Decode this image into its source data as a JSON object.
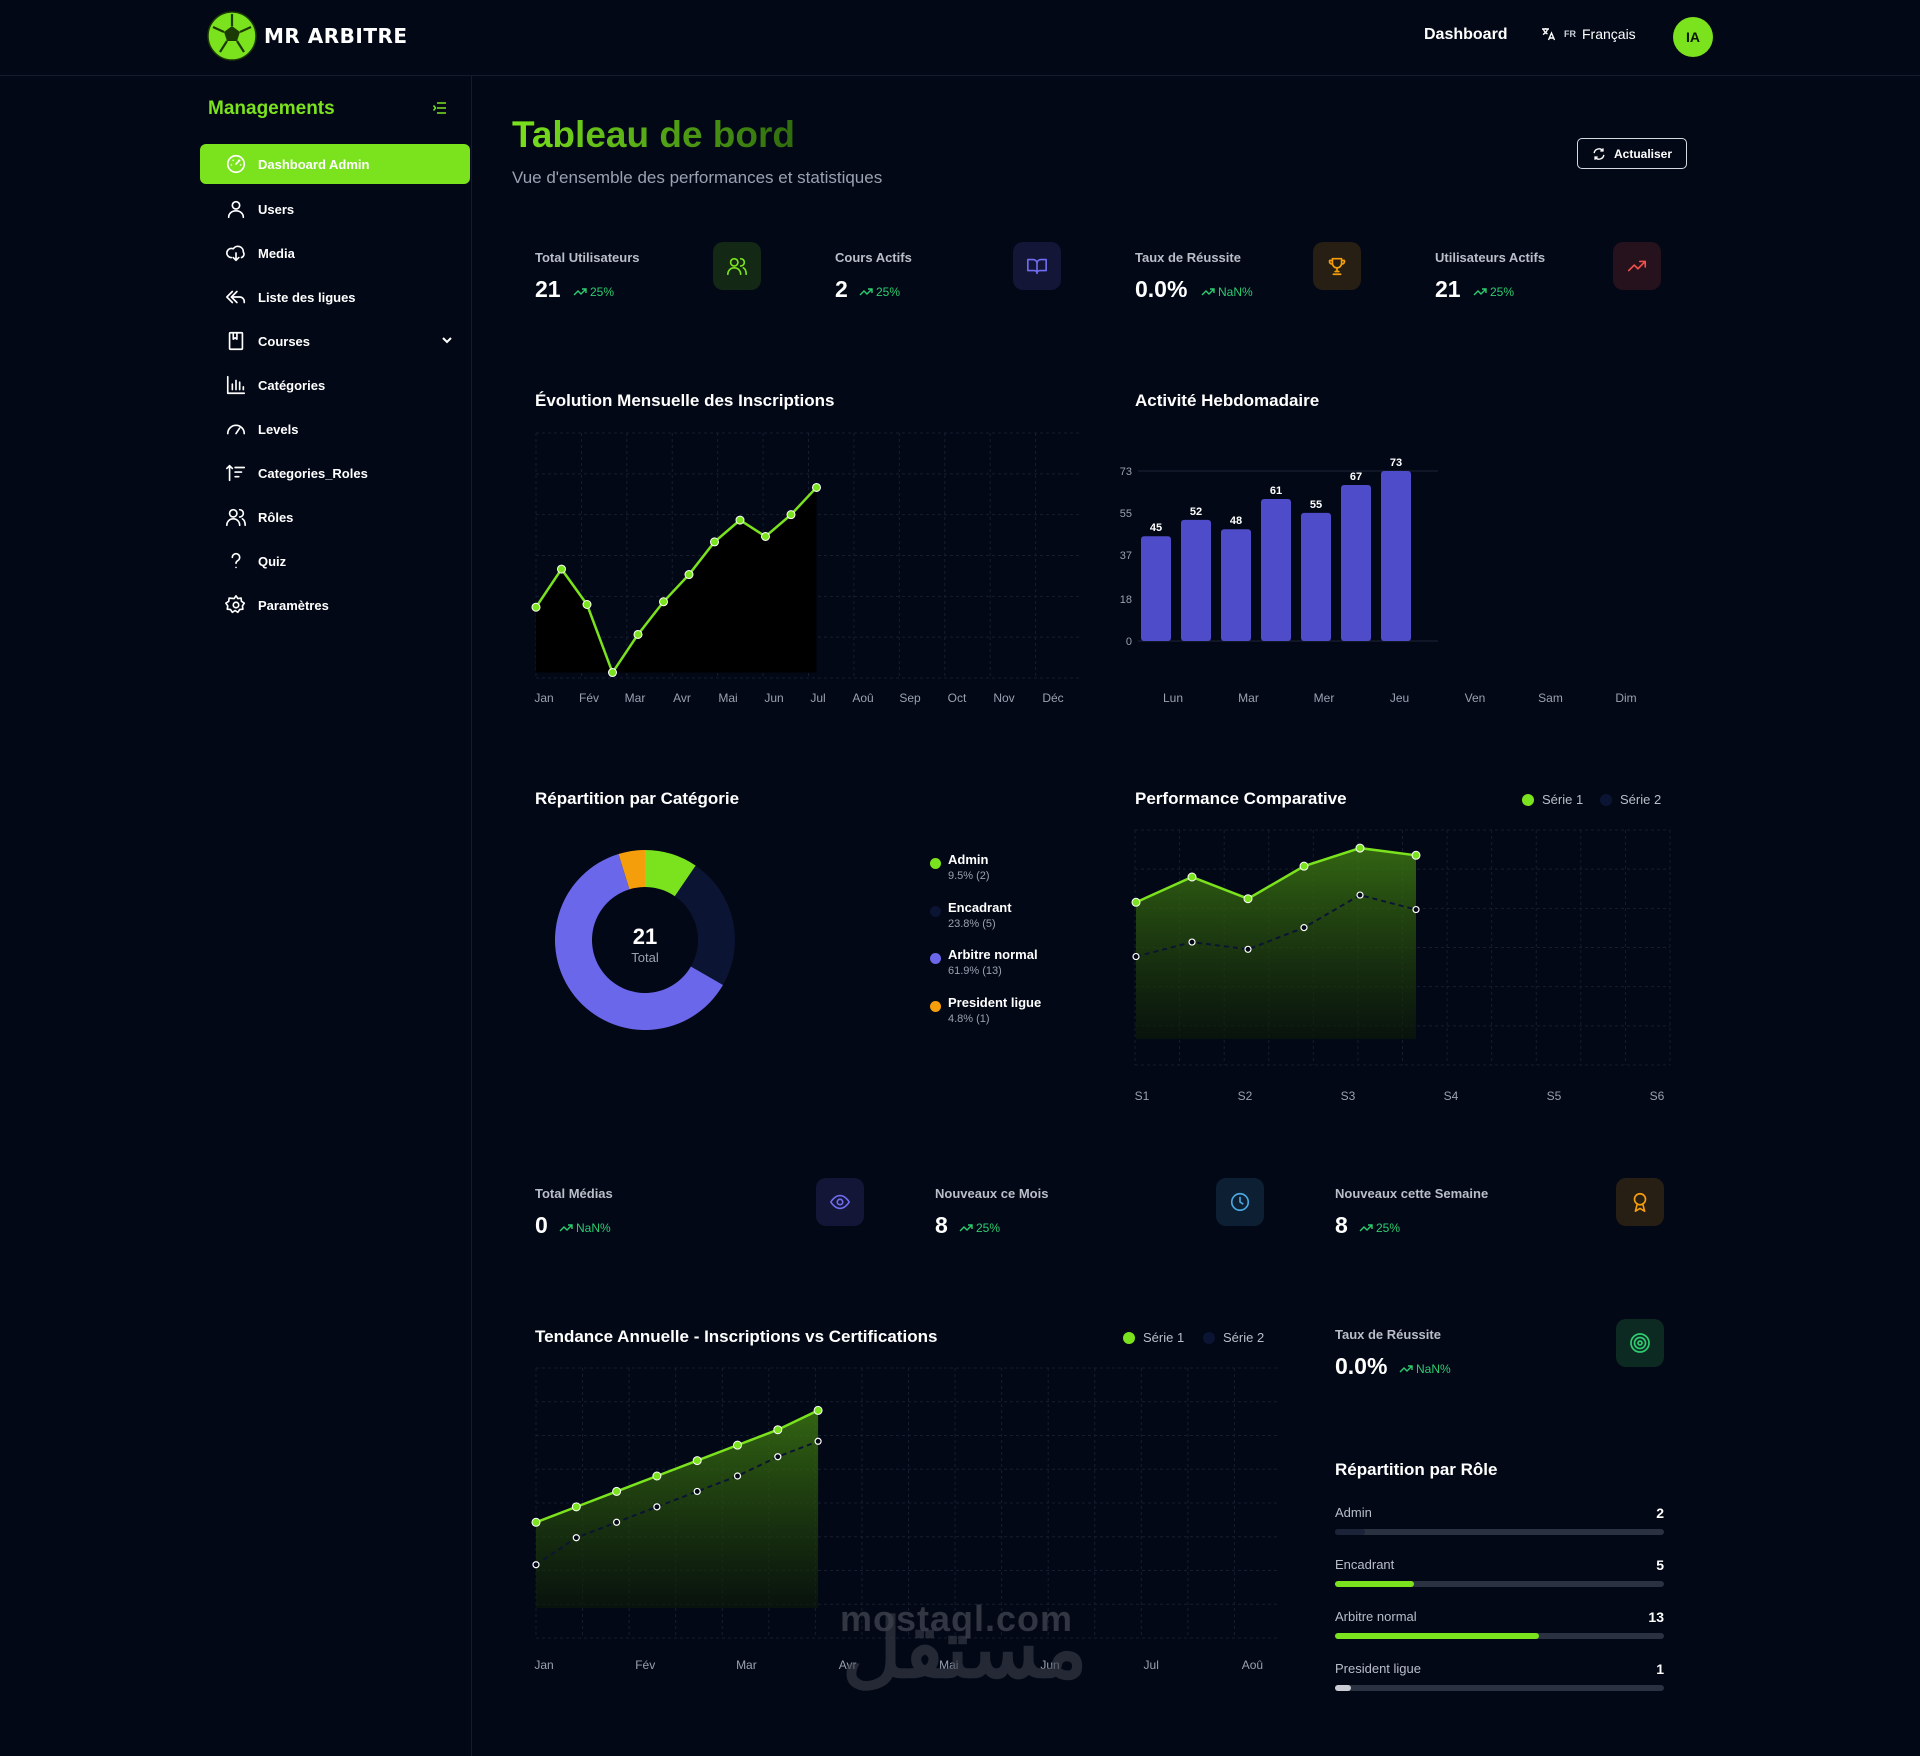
{
  "header": {
    "brand": "MR ARBITRE",
    "nav_label": "Dashboard",
    "lang_code": "FR",
    "lang_label": "Français",
    "avatar": "IA"
  },
  "sidebar": {
    "title": "Managements",
    "items": [
      {
        "label": "Dashboard Admin",
        "icon": "dashboard-icon",
        "active": true
      },
      {
        "label": "Users",
        "icon": "user-icon"
      },
      {
        "label": "Media",
        "icon": "cloud-download-icon"
      },
      {
        "label": "Liste des ligues",
        "icon": "reply-all-icon"
      },
      {
        "label": "Courses",
        "icon": "book-icon"
      },
      {
        "label": "Catégories",
        "icon": "bar-chart-icon"
      },
      {
        "label": "Levels",
        "icon": "gauge-icon"
      },
      {
        "label": "Categories_Roles",
        "icon": "sort-icon"
      },
      {
        "label": "Rôles",
        "icon": "users-icon"
      },
      {
        "label": "Quiz",
        "icon": "question-icon"
      },
      {
        "label": "Paramètres",
        "icon": "settings-icon"
      }
    ]
  },
  "main": {
    "title": "Tableau de bord",
    "subtitle": "Vue d'ensemble des performances et statistiques",
    "refresh_label": "Actualiser"
  },
  "stats_top": [
    {
      "label": "Total Utilisateurs",
      "value": "21",
      "trend": "25%",
      "icon": "users-icon",
      "color": "#7be31d"
    },
    {
      "label": "Cours Actifs",
      "value": "2",
      "trend": "25%",
      "icon": "book-open-icon",
      "color": "#6f6cf0"
    },
    {
      "label": "Taux de Réussite",
      "value": "0.0%",
      "trend": "NaN%",
      "icon": "trophy-icon",
      "color": "#f59e0b"
    },
    {
      "label": "Utilisateurs Actifs",
      "value": "21",
      "trend": "25%",
      "icon": "trending-up-icon",
      "color": "#f0504a"
    }
  ],
  "stats_mid": [
    {
      "label": "Total Médias",
      "value": "0",
      "trend": "NaN%",
      "icon": "eye-icon",
      "color": "#6f6cf0"
    },
    {
      "label": "Nouveaux ce Mois",
      "value": "8",
      "trend": "25%",
      "icon": "clock-icon",
      "color": "#4aa8e0"
    },
    {
      "label": "Nouveaux cette Semaine",
      "value": "8",
      "trend": "25%",
      "icon": "award-icon",
      "color": "#f59e0b"
    }
  ],
  "success_card": {
    "label": "Taux de Réussite",
    "value": "0.0%",
    "trend": "NaN%",
    "icon": "target-icon",
    "color": "#2ecc71"
  },
  "role_card": {
    "title": "Répartition par Rôle"
  },
  "chart_data": [
    {
      "type": "area",
      "title": "Évolution Mensuelle des Inscriptions",
      "categories": [
        "Jan",
        "Fév",
        "Mar",
        "Avr",
        "Mai",
        "Jun",
        "Jul",
        "Aoû",
        "Sep",
        "Oct",
        "Nov",
        "Déc"
      ],
      "points": [
        8,
        15,
        8.5,
        -4,
        3,
        9,
        14,
        20,
        24,
        21,
        25,
        30
      ],
      "ylim": [
        -5,
        40
      ],
      "color": "#7be31d"
    },
    {
      "type": "bar",
      "title": "Activité Hebdomadaire",
      "categories": [
        "Lun",
        "Mar",
        "Mer",
        "Jeu",
        "Ven",
        "Sam",
        "Dim"
      ],
      "values": [
        45,
        52,
        48,
        61,
        55,
        67,
        73
      ],
      "yticks": [
        0,
        18,
        37,
        55,
        73
      ],
      "ylim": [
        0,
        73
      ],
      "color": "#4f4cc9"
    },
    {
      "type": "pie",
      "title": "Répartition par Catégorie",
      "center_value": "21",
      "center_label": "Total",
      "slices": [
        {
          "name": "Admin",
          "value": 2,
          "pct": "9.5% (2)",
          "color": "#7be31d"
        },
        {
          "name": "Encadrant",
          "value": 5,
          "pct": "23.8% (5)",
          "color": "#0b1433"
        },
        {
          "name": "Arbitre normal",
          "value": 13,
          "pct": "61.9% (13)",
          "color": "#6a67ea"
        },
        {
          "name": "President ligue",
          "value": 1,
          "pct": "4.8% (1)",
          "color": "#f59e0b"
        }
      ]
    },
    {
      "type": "line",
      "title": "Performance Comparative",
      "categories": [
        "S1",
        "S2",
        "S3",
        "S4",
        "S5",
        "S6"
      ],
      "series": [
        {
          "name": "Série 1",
          "values": [
            65,
            72,
            66,
            75,
            80,
            78
          ],
          "color": "#7be31d"
        },
        {
          "name": "Série 2",
          "values": [
            50,
            54,
            52,
            58,
            67,
            63
          ],
          "color": "#0b1433"
        }
      ],
      "ylim": [
        20,
        85
      ]
    },
    {
      "type": "line",
      "title": "Tendance Annuelle - Inscriptions vs Certifications",
      "categories": [
        "Jan",
        "Fév",
        "Mar",
        "Avr",
        "Mai",
        "Jun",
        "Jul",
        "Aoû"
      ],
      "series": [
        {
          "name": "Série 1",
          "values": [
            30,
            34,
            38,
            42,
            46,
            50,
            54,
            59
          ],
          "color": "#7be31d"
        },
        {
          "name": "Série 2",
          "values": [
            19,
            26,
            30,
            34,
            38,
            42,
            47,
            51
          ],
          "color": "#0b1433"
        }
      ],
      "ylim": [
        0,
        70
      ]
    }
  ],
  "roles": [
    {
      "name": "Admin",
      "value": 2,
      "fraction": 0.09,
      "color": "#1a2338"
    },
    {
      "name": "Encadrant",
      "value": 5,
      "fraction": 0.24,
      "color": "#7be31d"
    },
    {
      "name": "Arbitre normal",
      "value": 13,
      "fraction": 0.62,
      "color": "#7be31d"
    },
    {
      "name": "President ligue",
      "value": 1,
      "fraction": 0.05,
      "color": "#c9ccd3"
    }
  ],
  "watermark": {
    "latin": "mostaql.com",
    "arabic": "مستقل"
  }
}
